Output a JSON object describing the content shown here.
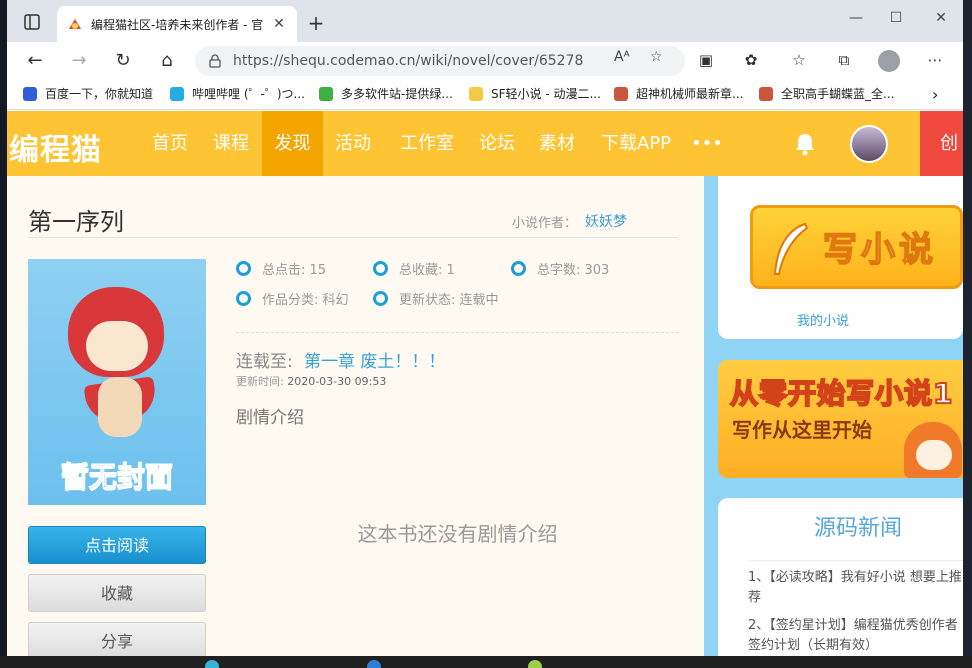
{
  "browser": {
    "tab_title": "编程猫社区-培养未来创作者 - 官",
    "tab_close": "✕",
    "new_tab": "+",
    "url": "https://shequ.codemao.cn/wiki/novel/cover/65278",
    "read_aloud": "Aᴬ",
    "bookmarks": [
      {
        "label": "百度一下，你就知道",
        "color": "#2f5fd8"
      },
      {
        "label": "哔哩哔哩 (゜-゜)つ...",
        "color": "#23ade5"
      },
      {
        "label": "多多软件站-提供绿...",
        "color": "#3cb043"
      },
      {
        "label": "SF轻小说 - 动漫二...",
        "color": "#f3c842"
      },
      {
        "label": "超神机械师最新章...",
        "color": "#c8553d"
      },
      {
        "label": "全职高手蝴蝶蓝_全...",
        "color": "#c8553d"
      }
    ]
  },
  "site": {
    "logo": "编程猫",
    "nav": [
      "首页",
      "课程",
      "发现",
      "活动",
      "工作室",
      "论坛",
      "素材",
      "下载APP",
      "•••"
    ],
    "active_nav": "发现",
    "create_button": "创"
  },
  "novel": {
    "title": "第一序列",
    "author_label": "小说作者：",
    "author": "妖妖梦",
    "cover_text": "暂无封面",
    "stats": [
      {
        "label": "总点击: 15"
      },
      {
        "label": "总收藏: 1"
      },
      {
        "label": "总字数: 303"
      },
      {
        "label": "作品分类: 科幻"
      },
      {
        "label": "更新状态: 连载中"
      }
    ],
    "serial_label": "连载至:",
    "serial_chapter": "第一章 废土！！！",
    "update_label": "更新时间:",
    "update_time": "2020-03-30 09:53",
    "synopsis_label": "剧情介绍",
    "no_synopsis": "这本书还没有剧情介绍",
    "buttons": {
      "read": "点击阅读",
      "favorite": "收藏",
      "share": "分享"
    }
  },
  "sidebar": {
    "write_banner": "写小说",
    "my_novels": "我的小说",
    "banner2_line1": "从零开始写小说1",
    "banner2_line2": "写作从这里开始",
    "news_title": "源码新闻",
    "news": [
      "1、【必读攻略】我有好小说 想要上推荐",
      "2、【签约星计划】编程猫优秀创作者签约计划（长期有效）"
    ]
  },
  "colors": {
    "brand_yellow": "#fec433",
    "active_nav": "#f5a500",
    "link_blue": "#3aa0d8",
    "create_red": "#f04a3e"
  }
}
